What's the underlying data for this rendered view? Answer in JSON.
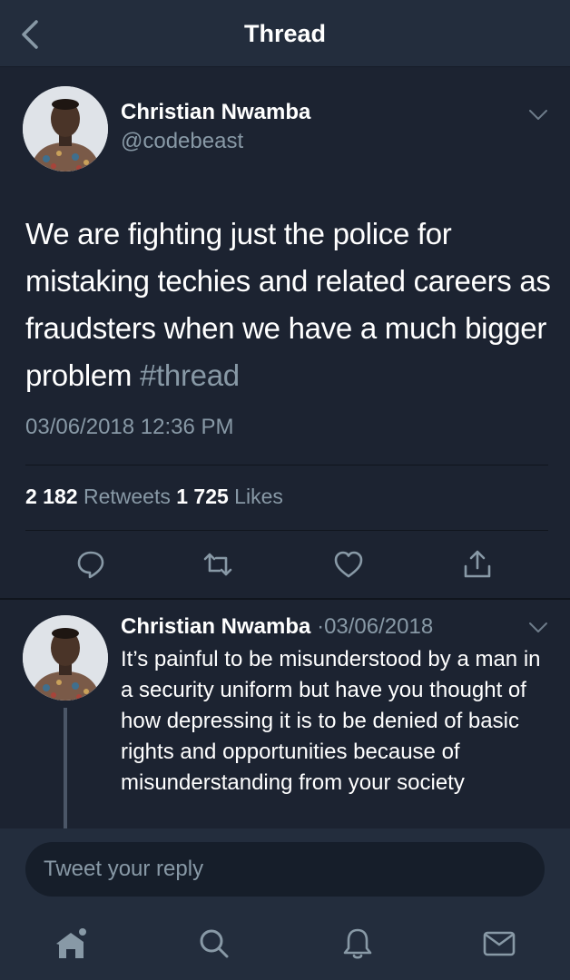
{
  "header": {
    "title": "Thread",
    "back_icon": "chevron-left-icon"
  },
  "main_tweet": {
    "author_name": "Christian Nwamba",
    "author_handle": "@codebeast",
    "text": "We are fighting just the police for mistaking techies and related careers as fraudsters when we have a much bigger problem ",
    "hashtag": "#thread",
    "date": "03/06/2018 12:36 PM",
    "retweets_count": "2 182",
    "retweets_label": "Retweets",
    "likes_count": "1 725",
    "likes_label": "Likes",
    "actions": [
      "reply-icon",
      "retweet-icon",
      "like-icon",
      "share-icon"
    ]
  },
  "reply_tweet": {
    "author_name": "Christian Nwamba",
    "separator": "·",
    "date": "03/06/2018",
    "text": "It’s painful to be misunderstood by a man in a security uniform but have you thought of how depressing it is to be denied of basic rights and opportunities because of misunderstanding from your society"
  },
  "reply_box": {
    "placeholder": "Tweet your reply"
  },
  "bottom_nav": [
    "home-icon",
    "search-icon",
    "notifications-icon",
    "messages-icon"
  ],
  "colors": {
    "background": "#1c2331",
    "header": "#232d3d",
    "secondary_text": "#8899a6",
    "divider": "#10151d"
  }
}
